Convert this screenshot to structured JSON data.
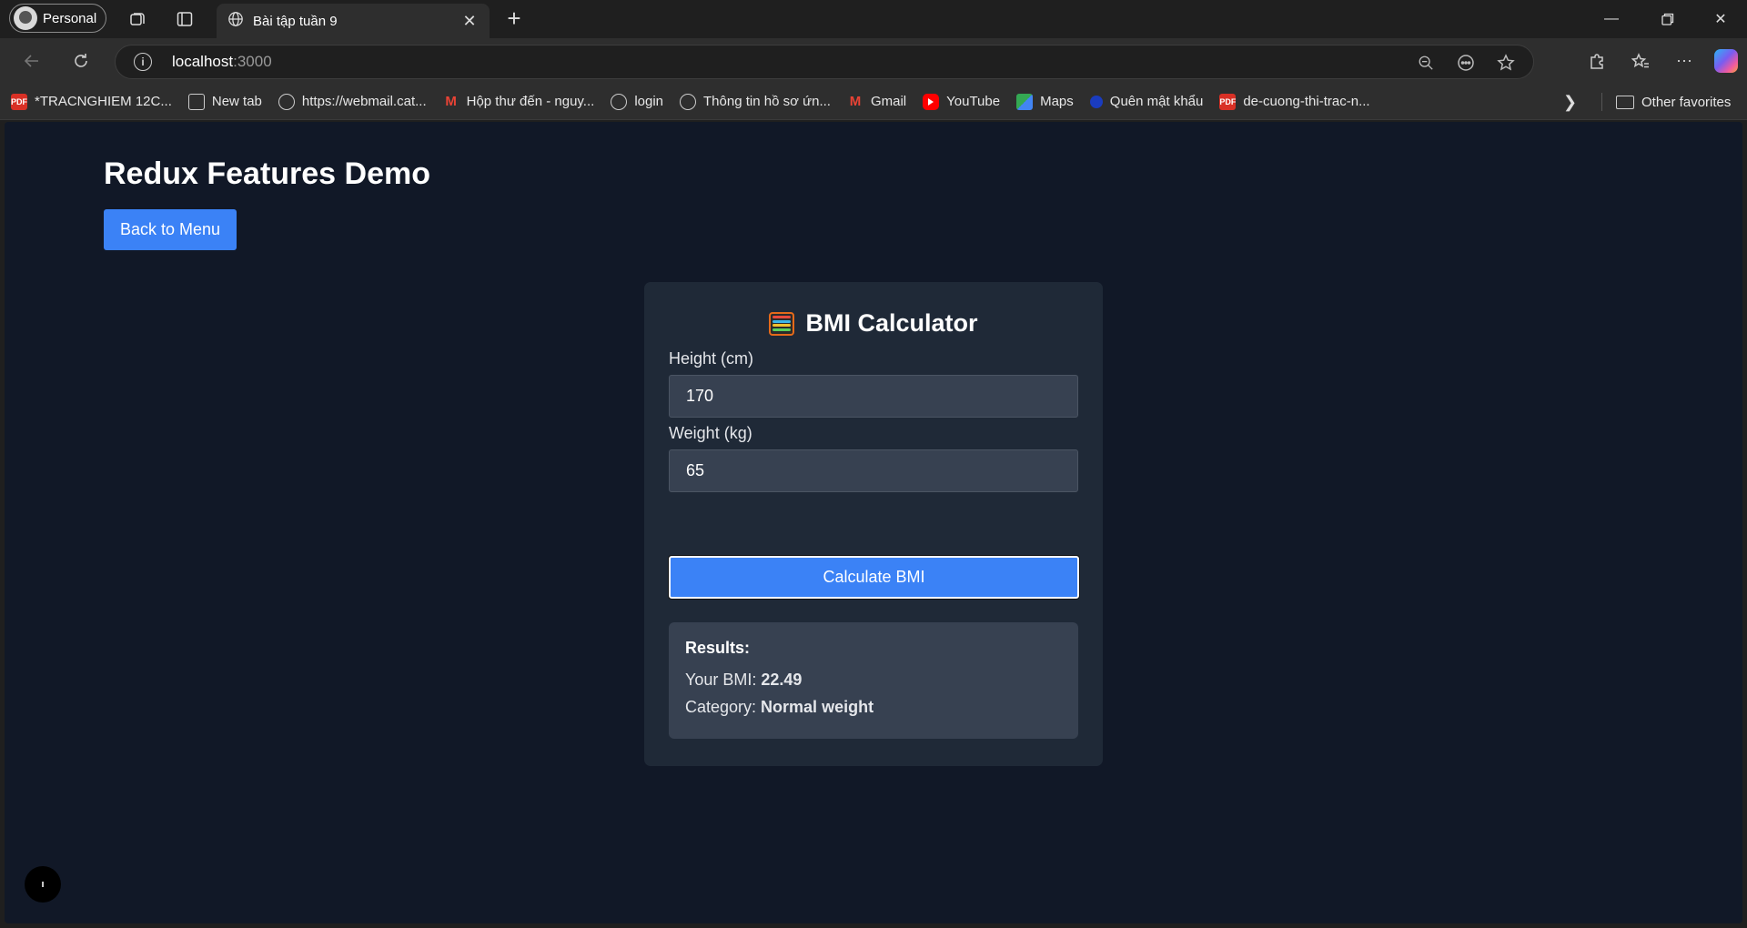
{
  "browser": {
    "profile_label": "Personal",
    "tab_title": "Bài tập tuần 9",
    "url_host": "localhost",
    "url_port": ":3000",
    "bookmarks": [
      {
        "label": "*TRACNGHIEM 12C...",
        "icon": "pdf-icon"
      },
      {
        "label": "New tab",
        "icon": "new-tab-icon"
      },
      {
        "label": "https://webmail.cat...",
        "icon": "globe-icon"
      },
      {
        "label": "Hộp thư đến - nguy...",
        "icon": "gmail-icon"
      },
      {
        "label": "login",
        "icon": "globe-icon"
      },
      {
        "label": "Thông tin hồ sơ ứn...",
        "icon": "globe-icon"
      },
      {
        "label": "Gmail",
        "icon": "gmail-icon"
      },
      {
        "label": "YouTube",
        "icon": "youtube-icon"
      },
      {
        "label": "Maps",
        "icon": "maps-icon"
      },
      {
        "label": "Quên mật khẩu",
        "icon": "site-icon"
      },
      {
        "label": "de-cuong-thi-trac-n...",
        "icon": "pdf-icon"
      }
    ],
    "other_favorites": "Other favorites"
  },
  "page": {
    "title": "Redux Features Demo",
    "back_button": "Back to Menu",
    "dev_badge": "ı"
  },
  "bmi": {
    "title": "BMI Calculator",
    "height_label": "Height (cm)",
    "height_value": "170",
    "weight_label": "Weight (kg)",
    "weight_value": "65",
    "calculate_button": "Calculate BMI",
    "results_title": "Results:",
    "bmi_label": "Your BMI: ",
    "bmi_value": "22.49",
    "category_label": "Category: ",
    "category_value": "Normal weight"
  },
  "colors": {
    "page_bg": "#111827",
    "card_bg": "#1f2937",
    "input_bg": "#374151",
    "accent": "#3b82f6"
  }
}
